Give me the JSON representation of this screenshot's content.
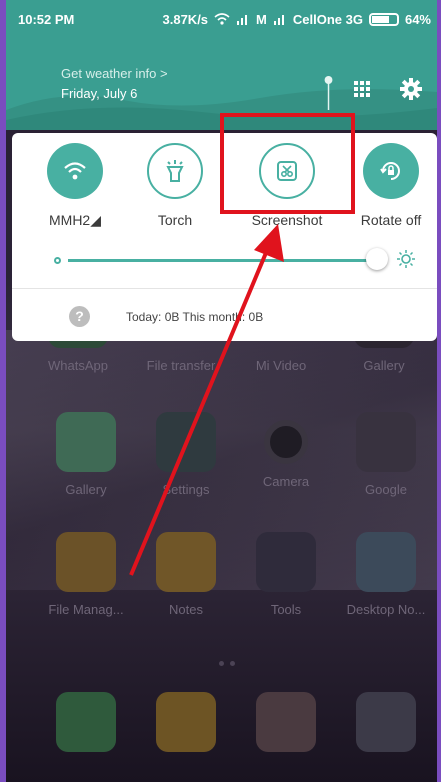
{
  "status_bar": {
    "time": "10:52 PM",
    "net_speed": "3.87K/s",
    "carrier_1": "M",
    "carrier_2": "CellOne 3G",
    "battery": "64%"
  },
  "weather": {
    "link": "Get weather info >",
    "date": "Friday, July 6"
  },
  "toggles": [
    {
      "label": "MMH2◢",
      "icon": "wifi-icon",
      "state": "on"
    },
    {
      "label": "Torch",
      "icon": "torch-icon",
      "state": "off"
    },
    {
      "label": "Screenshot",
      "icon": "scissors-icon",
      "state": "off"
    },
    {
      "label": "Rotate off",
      "icon": "rotate-lock-icon",
      "state": "on"
    }
  ],
  "brightness": {
    "level": 1.0
  },
  "data_usage": {
    "today": "Today: 0B",
    "month": "This month: 0B",
    "help": "?"
  },
  "home_apps": [
    {
      "label": "WhatsApp"
    },
    {
      "label": "File transfer"
    },
    {
      "label": "Mi Video"
    },
    {
      "label": "Gallery"
    },
    {
      "label": "Gallery"
    },
    {
      "label": "Settings"
    },
    {
      "label": "Camera"
    },
    {
      "label": "Google"
    },
    {
      "label": "File Manag..."
    },
    {
      "label": "Notes"
    },
    {
      "label": "Tools"
    },
    {
      "label": "Desktop No..."
    }
  ],
  "dock": [
    {
      "icon": "phone-icon"
    },
    {
      "icon": "messages-icon"
    },
    {
      "icon": "chrome-icon"
    },
    {
      "icon": "play-store-icon"
    }
  ],
  "colors": {
    "accent": "#48b0a2",
    "shade": "#3a9e91",
    "highlight": "#e0131d"
  }
}
